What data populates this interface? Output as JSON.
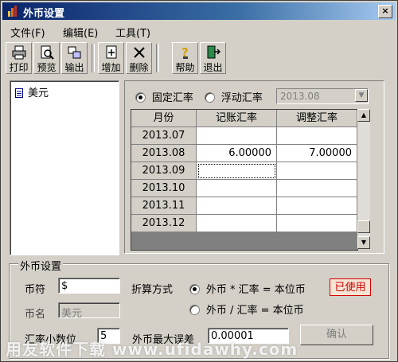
{
  "window": {
    "title": "外币设置",
    "close_glyph": "×"
  },
  "menu": [
    "文件(F)",
    "编辑(E)",
    "工具(T)"
  ],
  "toolbar": {
    "print": "打印",
    "preview": "预览",
    "export": "输出",
    "add": "增加",
    "delete": "删除",
    "help": "帮助",
    "exit": "退出"
  },
  "currency_list": {
    "items": [
      "美元"
    ]
  },
  "rate_mode": {
    "fixed": "固定汇率",
    "floating": "浮动汇率",
    "selected": "fixed",
    "period": "2013.08"
  },
  "rate_table": {
    "headers": [
      "月份",
      "记账汇率",
      "调整汇率"
    ],
    "rows": [
      {
        "month": "2013.07",
        "book_rate": "",
        "adjust_rate": ""
      },
      {
        "month": "2013.08",
        "book_rate": "6.00000",
        "adjust_rate": "7.00000"
      },
      {
        "month": "2013.09",
        "book_rate": "",
        "adjust_rate": ""
      },
      {
        "month": "2013.10",
        "book_rate": "",
        "adjust_rate": ""
      },
      {
        "month": "2013.11",
        "book_rate": "",
        "adjust_rate": ""
      },
      {
        "month": "2013.12",
        "book_rate": "",
        "adjust_rate": ""
      }
    ]
  },
  "settings": {
    "group_title": "外币设置",
    "symbol_label": "币符",
    "symbol_value": "$",
    "name_label": "币名",
    "name_value": "美元",
    "conversion_label": "折算方式",
    "conversion_multiply": "外币 * 汇率 = 本位币",
    "conversion_divide": "外币 / 汇率 = 本位币",
    "conversion_selected": "multiply",
    "in_use_badge": "已使用",
    "decimals_label": "汇率小数位",
    "decimals_value": "5",
    "max_error_label": "外币最大误差",
    "max_error_value": "0.00001",
    "confirm_button": "确认"
  },
  "watermark": "用友软件下载 www.ufidawhy.com",
  "colors": {
    "titlebar_start": "#0a246a",
    "titlebar_end": "#a6caf0",
    "badge": "#d00000",
    "face": "#d4d0c8"
  }
}
